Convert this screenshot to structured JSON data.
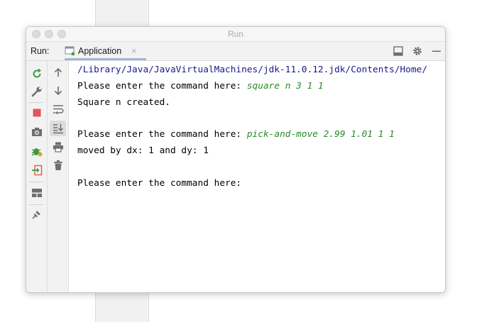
{
  "window": {
    "title": "Run"
  },
  "toolbar": {
    "run_label": "Run:",
    "tab_label": "Application",
    "tab_close": "×",
    "icons": [
      "layout-icon",
      "gear-icon",
      "minimize-icon"
    ]
  },
  "left_toolbar_1": [
    "rerun-icon",
    "wrench-icon",
    "stop-icon",
    "camera-icon",
    "debug-icon",
    "exit-icon",
    "layout-icon",
    "pin-icon"
  ],
  "left_toolbar_2": [
    "up-arrow-icon",
    "down-arrow-icon",
    "soft-wrap-icon",
    "scroll-to-end-icon",
    "print-icon",
    "trash-icon"
  ],
  "console": {
    "line1": "/Library/Java/JavaVirtualMachines/jdk-11.0.12.jdk/Contents/Home/",
    "prompt1": "Please enter the command here: ",
    "input1": "square n 3 1 1",
    "output1": "Square n created.",
    "prompt2": "Please enter the command here: ",
    "input2": "pick-and-move 2.99 1.01 1 1",
    "output2": "moved by dx: 1 and dy: 1",
    "prompt3": "Please enter the command here:"
  },
  "colors": {
    "input_text": "#2a8a2a",
    "path_text": "#1a1a8a",
    "stop": "#e05555",
    "rerun": "#3c9a3c"
  }
}
